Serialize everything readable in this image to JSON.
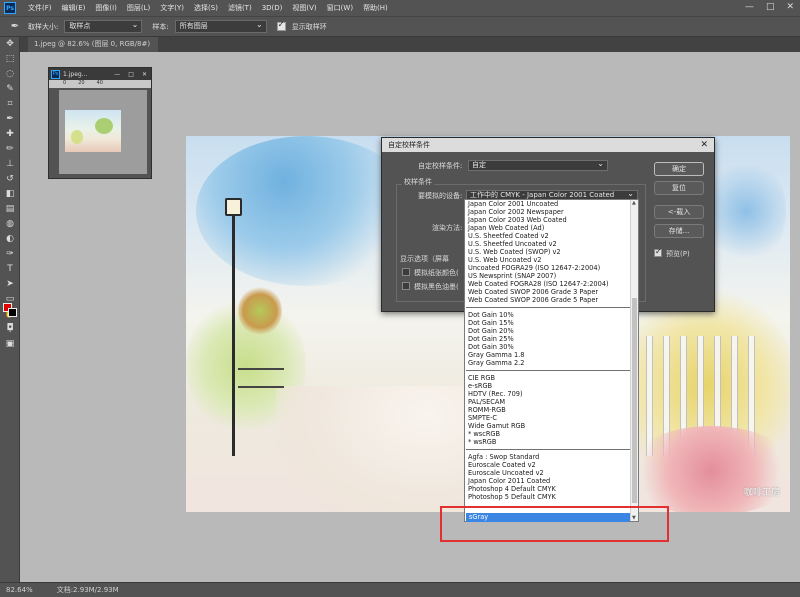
{
  "menu": {
    "logo": "Ps",
    "items": [
      "文件(F)",
      "编辑(E)",
      "图像(I)",
      "图层(L)",
      "文字(Y)",
      "选择(S)",
      "滤镜(T)",
      "3D(D)",
      "视图(V)",
      "窗口(W)",
      "帮助(H)"
    ],
    "window_controls": [
      "—",
      "□",
      "✕"
    ]
  },
  "options": {
    "sample_size_label": "取样大小:",
    "sample_size_value": "取样点",
    "sample_label": "样本:",
    "sample_value": "所有图层",
    "show_ring_label": "显示取样环"
  },
  "tab": {
    "title": "1.jpeg @ 82.6% (图层 0, RGB/8#) *",
    "close": "×"
  },
  "nav_panel": {
    "title": "1.jpeg...",
    "ruler": [
      "0",
      "20",
      "40"
    ],
    "controls": [
      "—",
      "□",
      "✕"
    ]
  },
  "image": {
    "watermark": "咖啡工房"
  },
  "dialog": {
    "title": "自定校样条件",
    "close": "✕",
    "custom_condition_label": "自定校样条件:",
    "custom_condition_value": "自定",
    "group_label": "校样条件",
    "device_label": "要模拟的设备:",
    "device_value": "工作中的 CMYK - Japan Color 2001 Coated",
    "render_label": "渲染方法:",
    "display_options_label": "显示选项（屏幕",
    "simulate_paper_label": "模拟纸张颜色(",
    "simulate_black_label": "模拟黑色油墨(",
    "buttons": {
      "ok": "确定",
      "reset": "复位",
      "load": "<-载入",
      "save": "存储..."
    },
    "preview_label": "预览(P)"
  },
  "dropdown": {
    "group1": [
      "Japan Color 2001 Uncoated",
      "Japan Color 2002 Newspaper",
      "Japan Color 2003 Web Coated",
      "Japan Web Coated (Ad)",
      "U.S. Sheetfed Coated v2",
      "U.S. Sheetfed Uncoated v2",
      "U.S. Web Coated (SWOP) v2",
      "U.S. Web Uncoated v2",
      "Uncoated FOGRA29 (ISO 12647-2:2004)",
      "US Newsprint (SNAP 2007)",
      "Web Coated FOGRA28 (ISO 12647-2:2004)",
      "Web Coated SWOP 2006 Grade 3 Paper",
      "Web Coated SWOP 2006 Grade 5 Paper"
    ],
    "group2": [
      "Dot Gain 10%",
      "Dot Gain 15%",
      "Dot Gain 20%",
      "Dot Gain 25%",
      "Dot Gain 30%",
      "Gray Gamma 1.8",
      "Gray Gamma 2.2"
    ],
    "group3": [
      "CIE RGB",
      "e-sRGB",
      "HDTV (Rec. 709)",
      "PAL/SECAM",
      "ROMM-RGB",
      "SMPTE-C",
      "Wide Gamut RGB",
      "* wscRGB",
      "* wsRGB"
    ],
    "group4": [
      "Agfa : Swop Standard",
      "Euroscale Coated v2",
      "Euroscale Uncoated v2",
      "Japan Color 2011 Coated",
      "Photoshop 4 Default CMYK",
      "Photoshop 5 Default CMYK"
    ],
    "selected": "sGray"
  },
  "status": {
    "zoom": "82.64%",
    "doc": "文档:2.93M/2.93M"
  },
  "colors": {
    "foreground": "#e00000",
    "background": "#000000",
    "highlight": "#e23030",
    "selection": "#3b86e3"
  }
}
